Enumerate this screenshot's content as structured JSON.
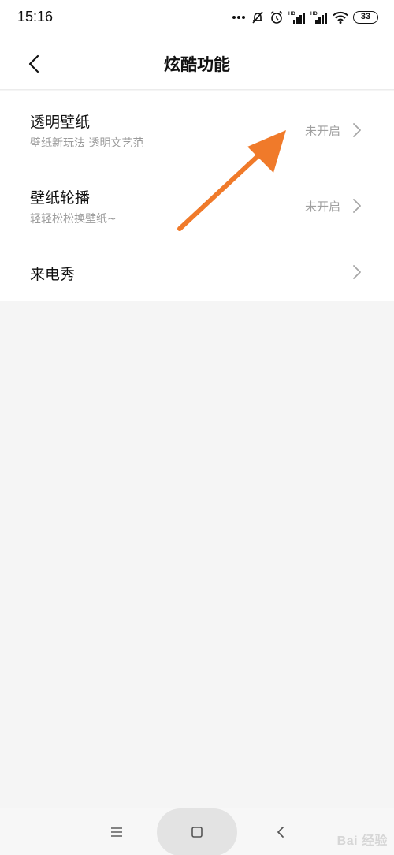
{
  "status_bar": {
    "time": "15:16",
    "battery": "33",
    "icons": [
      "more-dots-icon",
      "mute-bell-icon",
      "alarm-icon",
      "hd-signal-icon",
      "hd-signal-icon",
      "wifi-icon",
      "battery-icon"
    ],
    "hd_label": "HD"
  },
  "header": {
    "title": "炫酷功能",
    "back_icon": "chevron-left-icon"
  },
  "settings": [
    {
      "title": "透明壁纸",
      "subtitle": "壁纸新玩法 透明文艺范",
      "status": "未开启"
    },
    {
      "title": "壁纸轮播",
      "subtitle": "轻轻松松换壁纸~",
      "status": "未开启"
    },
    {
      "title": "来电秀"
    }
  ],
  "annotation": {
    "color": "#f07a2a",
    "icon": "arrow-annotation"
  },
  "nav_bar": {
    "icons": [
      "menu-icon",
      "home-square-icon",
      "back-chevron-icon"
    ]
  },
  "watermark": {
    "text": "Bai 经验"
  }
}
